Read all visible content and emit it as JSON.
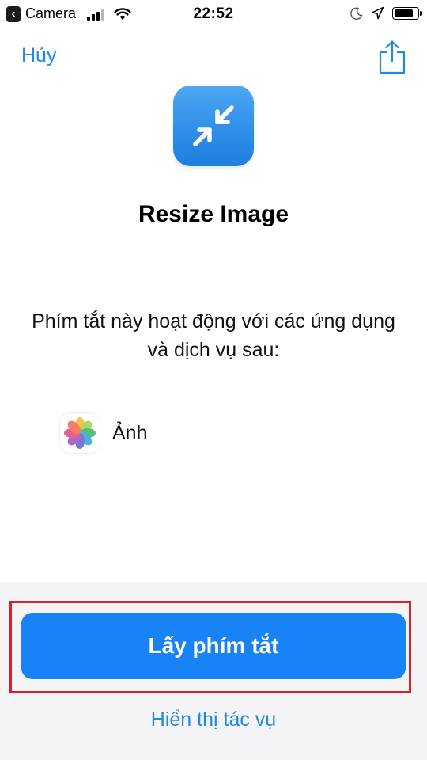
{
  "status_bar": {
    "back_app": "Camera",
    "time": "22:52",
    "signal_bars": 4,
    "signal_active": 3,
    "battery_level": 0.85
  },
  "nav": {
    "cancel_label": "Hủy",
    "share_icon": "share-icon"
  },
  "shortcut": {
    "icon": "resize-arrows-icon",
    "title": "Resize Image",
    "description": "Phím tắt này hoạt động với các ứng dụng và dịch vụ sau:"
  },
  "apps": [
    {
      "icon": "photos-icon",
      "label": "Ảnh"
    }
  ],
  "actions": {
    "primary_label": "Lấy phím tắt",
    "secondary_label": "Hiển thị tác vụ"
  },
  "colors": {
    "accent": "#1f8ae0",
    "button": "#1783f7",
    "highlight": "#d3242b"
  }
}
